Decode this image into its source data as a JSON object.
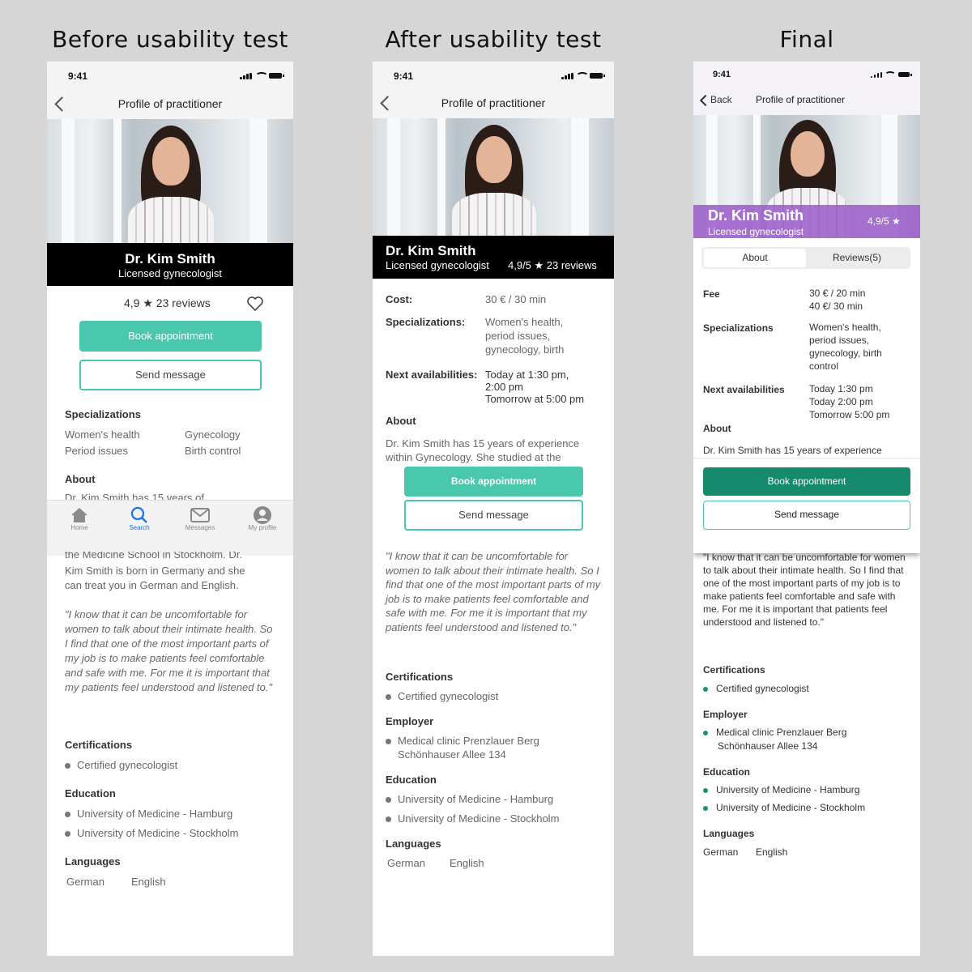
{
  "titles": {
    "before": "Before usability test",
    "after": "After usability test",
    "final": "Final"
  },
  "before": {
    "status_time": "9:41",
    "nav_title": "Profile of practitioner",
    "name": "Dr. Kim Smith",
    "subtitle": "Licensed gynecologist",
    "rating": "4,9 ★ 23 reviews",
    "book_label": "Book appointment",
    "message_label": "Send message",
    "specializations_heading": "Specializations",
    "spec_1": "Women's health",
    "spec_2": "Gynecology",
    "spec_3": "Period issues",
    "spec_4": "Birth control",
    "about_heading": "About",
    "about_cut": "Dr. Kim Smith has 15 years of",
    "tabs": {
      "home": "Home",
      "search": "Search",
      "messages": "Messages",
      "profile": "My profile"
    },
    "about_cont_1": "the Medicine School in Stockholm. Dr.",
    "about_cont_2": "Kim Smith is born in Germany and she",
    "about_cont_3": "can treat you in German and English.",
    "quote": "\"I know that it can be uncomfortable for women to talk about their intimate health. So I find that one of the most important parts of my job is to make patients feel comfortable and safe with me. For me it is important that my patients feel understood and listened to.\"",
    "certifications_heading": "Certifications",
    "cert_1": "Certified gynecologist",
    "education_heading": "Education",
    "edu_1": "University of Medicine - Hamburg",
    "edu_2": "University of Medicine - Stockholm",
    "languages_heading": "Languages",
    "lang_1": "German",
    "lang_2": "English"
  },
  "after": {
    "status_time": "9:41",
    "nav_title": "Profile of practitioner",
    "name": "Dr. Kim Smith",
    "subtitle": "Licensed gynecologist",
    "rating": "4,9/5 ★ 23 reviews",
    "cost_label": "Cost:",
    "cost_value": "30 € / 30 min",
    "spec_label": "Specializations:",
    "spec_value_1": "Women's health,",
    "spec_value_2": "period issues,",
    "spec_value_3": "gynecology, birth",
    "next_label": "Next availabilities:",
    "next_1": "Today at 1:30 pm,",
    "next_2": "2:00 pm",
    "next_3": "Tomorrow at 5:00 pm",
    "about_heading": "About",
    "about_1": "Dr. Kim Smith has 15 years of experience",
    "about_2": "within Gynecology. She studied at the",
    "book_label": "Book appointment",
    "message_label": "Send message",
    "quote": "\"I know that it can be uncomfortable for women to talk about their intimate health. So I find that one of the most important parts of my job is to make patients feel comfortable and safe with me. For me it is important that my patients feel understood and listened to.\"",
    "certifications_heading": "Certifications",
    "cert_1": "Certified gynecologist",
    "employer_heading": "Employer",
    "employer_1": "Medical clinic Prenzlauer Berg",
    "employer_2": "Schönhauser Allee 134",
    "education_heading": "Education",
    "edu_1": "University of Medicine - Hamburg",
    "edu_2": "University of Medicine - Stockholm",
    "languages_heading": "Languages",
    "lang_1": "German",
    "lang_2": "English"
  },
  "final": {
    "status_time": "9:41",
    "back_label": "Back",
    "nav_title": "Profile of practitioner",
    "name": "Dr. Kim Smith",
    "subtitle": "Licensed gynecologist",
    "rating": "4,9/5 ★",
    "tab_about": "About",
    "tab_reviews": "Reviews",
    "tab_reviews_count": "(5)",
    "fee_label": "Fee",
    "fee_1": "30 € / 20 min",
    "fee_2": "40 €/ 30 min",
    "spec_label": "Specializations",
    "spec_1": "Women's health,",
    "spec_2": "period issues,",
    "spec_3": "gynecology, birth",
    "spec_4": "control",
    "next_label": "Next availabilities",
    "next_1": "Today 1:30 pm",
    "next_2": "Today 2:00 pm",
    "next_3": "Tomorrow 5:00 pm",
    "about_heading": "About",
    "about_1": "Dr. Kim Smith has 15 years of experience",
    "book_label": "Book appointment",
    "message_label": "Send message",
    "quote": "\"I know that it can be uncomfortable for women to talk about their intimate health. So I find that one of the most important parts of my job is to make patients feel comfortable and safe with me. For me it is important that patients feel understood and listened to.\"",
    "certifications_heading": "Certifications",
    "cert_1": "Certified gynecologist",
    "employer_heading": "Employer",
    "employer_1": "Medical clinic Prenzlauer Berg",
    "employer_2": "Schönhauser Allee 134",
    "education_heading": "Education",
    "edu_1": "University of Medicine - Hamburg",
    "edu_2": "University of Medicine - Stockholm",
    "languages_heading": "Languages",
    "lang_1": "German",
    "lang_2": "English"
  },
  "colors": {
    "teal": "#49c8ad",
    "dark_green": "#168a6c",
    "purple": "#9b5fc9",
    "black_bar": "#000000"
  },
  "icons": {
    "status": [
      "signal-icon",
      "wifi-icon",
      "battery-icon"
    ],
    "nav": "chevron-left-icon",
    "rating": "star-icon",
    "favorite": "heart-icon",
    "tabbar": [
      "home-icon",
      "search-icon",
      "mail-icon",
      "user-icon"
    ]
  }
}
